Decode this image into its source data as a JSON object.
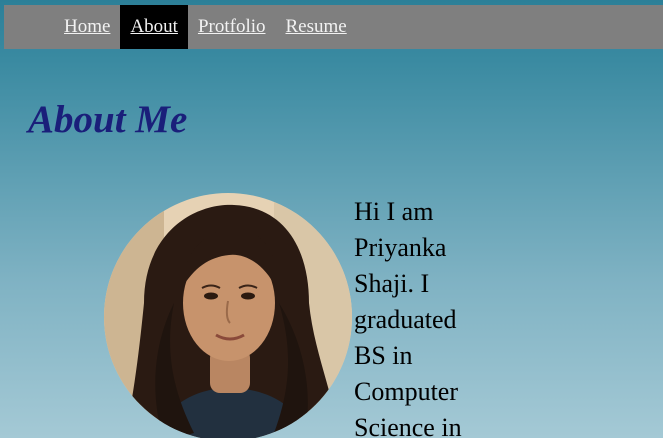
{
  "nav": {
    "items": [
      {
        "label": "Home"
      },
      {
        "label": "About"
      },
      {
        "label": "Protfolio"
      },
      {
        "label": "Resume"
      }
    ]
  },
  "colors": {
    "nav_bg": "#7f7f7f",
    "nav_active_bg": "#000000",
    "title_color": "#1a1f7a",
    "page_bg_top": "#2c7f98",
    "page_bg_bottom": "#a4c9d5"
  },
  "page": {
    "title": "About Me"
  },
  "about": {
    "photo_icon": "profile-photo",
    "bio": "Hi I am Priyanka Shaji. I graduated BS in Computer Science in"
  }
}
